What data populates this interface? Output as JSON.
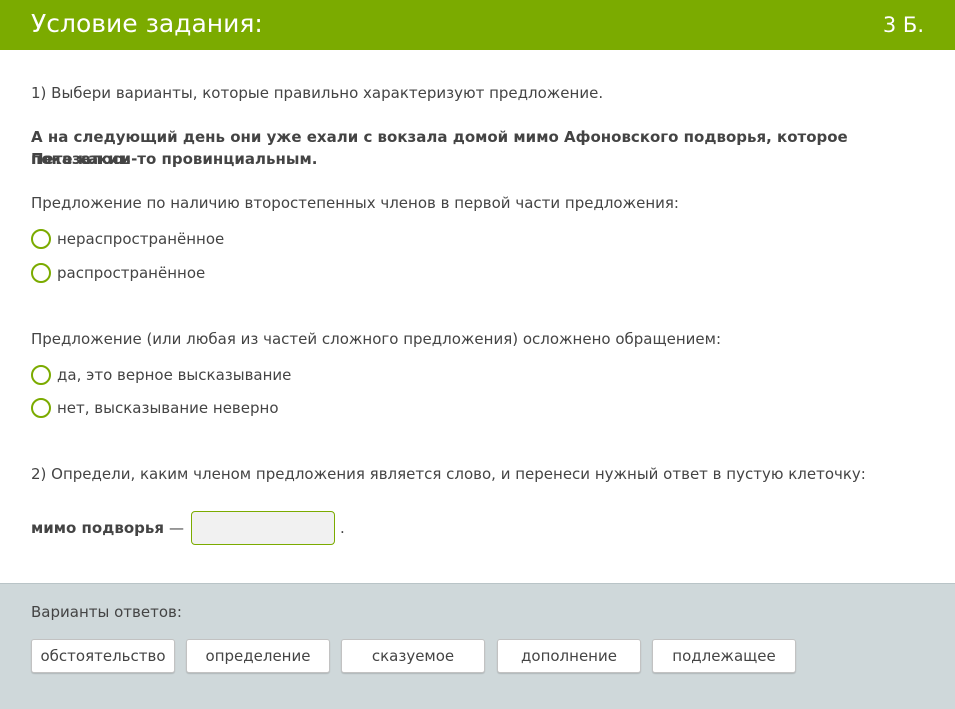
{
  "header": {
    "title": "Условие задания:",
    "score": "3 Б."
  },
  "task1": {
    "instruction": "1) Выбери варианты, которые правильно характеризуют предложение.",
    "sentence_line1": "А на следующий день они уже ехали с вокзала домой мимо Афоновского подворья, которое показалось",
    "sentence_line2": "Пете каким-то провинциальным.",
    "question1": {
      "text": "Предложение по наличию второстепенных членов в первой части предложения:",
      "options": [
        "нераспространённое",
        "распространённое"
      ]
    },
    "question2": {
      "text": "Предложение (или любая из частей сложного предложения) осложнено обращением:",
      "options": [
        "да, это верное высказывание",
        "нет, высказывание неверно"
      ]
    }
  },
  "task2": {
    "instruction": "2) Определи, каким членом предложения является слово, и перенеси нужный ответ в пустую клеточку:",
    "phrase": "мимо подворья",
    "dash": "—",
    "period": "."
  },
  "footer": {
    "title": "Варианты ответов:",
    "chips": [
      "обстоятельство",
      "определение",
      "сказуемое",
      "дополнение",
      "подлежащее"
    ]
  },
  "colors": {
    "accent": "#7bab00",
    "footer_bg": "#cfd8da"
  }
}
